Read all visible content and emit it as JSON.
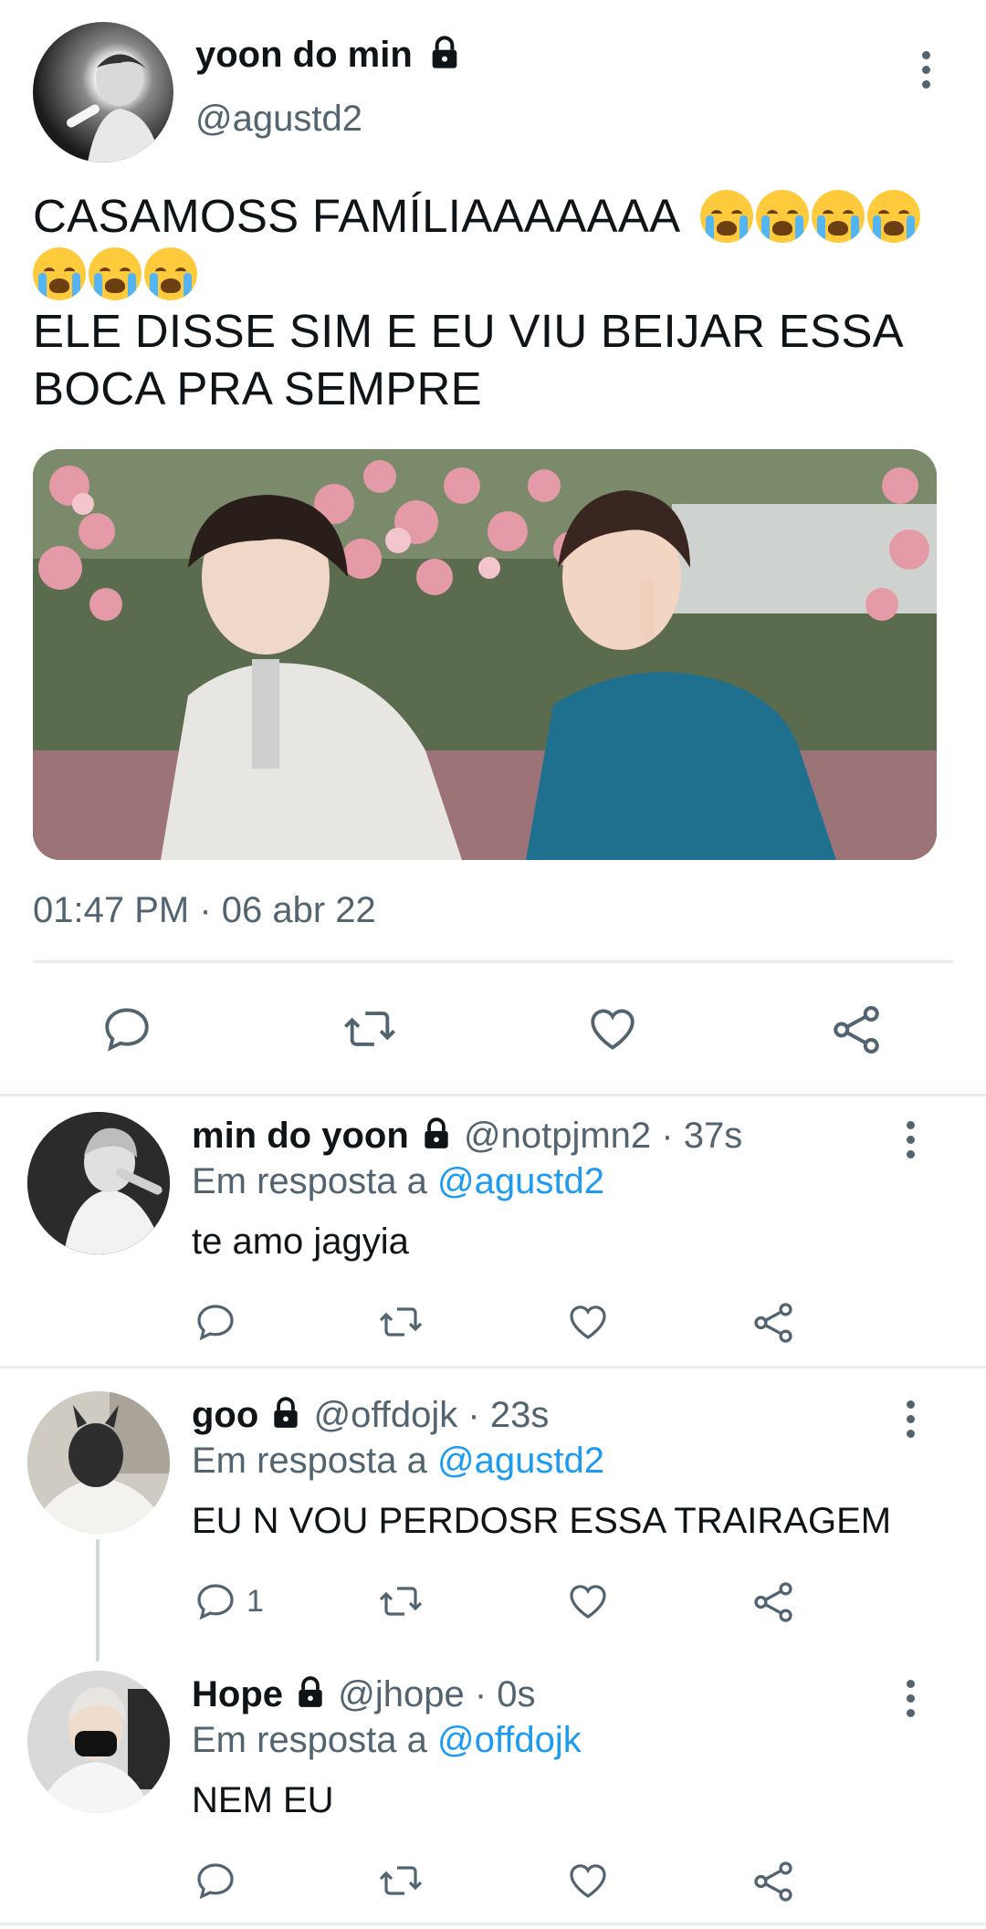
{
  "main_tweet": {
    "display_name": "yoon do min",
    "handle": "@agustd2",
    "text_line1": "CASAMOSS FAMÍLIAAAAAAA",
    "text_line3": "ELE DISSE SIM E EU VIU BEIJAR ESSA",
    "text_line4": "BOCA PRA SEMPRE",
    "emoji_row1": 4,
    "emoji_row2": 3,
    "emoji_name": "loudly-crying-face",
    "timestamp": "01:47 PM · 06 abr 22",
    "icons": [
      "reply-icon",
      "retweet-icon",
      "like-icon",
      "share-icon"
    ]
  },
  "replies": [
    {
      "display_name": "min do yoon",
      "handle_time": "@notpjmn2 · 37s",
      "reply_prefix": "Em resposta a",
      "reply_to": "@agustd2",
      "text": "te amo jagyia",
      "reply_count": ""
    },
    {
      "display_name": "goo",
      "handle_time": "@offdojk · 23s",
      "reply_prefix": "Em resposta a",
      "reply_to": "@agustd2",
      "text": "EU N VOU PERDOSR ESSA TRAIRAGEM",
      "reply_count": "1"
    },
    {
      "display_name": "Hope",
      "handle_time": "@jhope · 0s",
      "reply_prefix": "Em resposta a",
      "reply_to": "@offdojk",
      "text": "NEM EU",
      "reply_count": ""
    }
  ],
  "colors": {
    "link_blue": "#1d9bf0",
    "secondary_grey": "#536471",
    "divider": "#e7ecef"
  }
}
